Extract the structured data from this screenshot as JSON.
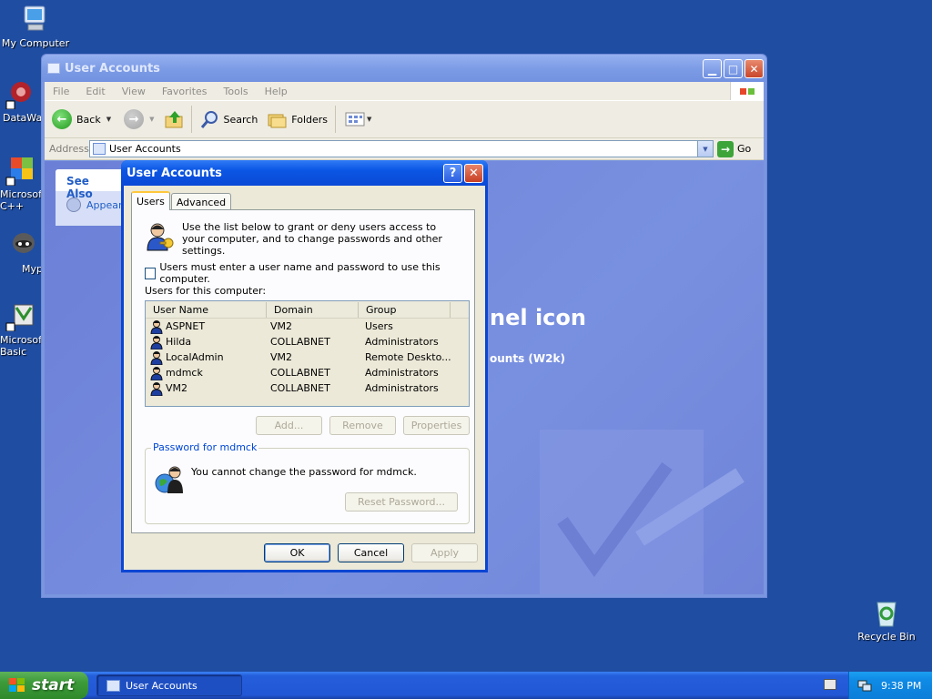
{
  "desktop": {
    "icons": [
      {
        "label": "My Computer"
      },
      {
        "label": "DataWa"
      },
      {
        "label": "Microsoft C++"
      },
      {
        "label": "Myp"
      },
      {
        "label": "Microsoft Basic"
      },
      {
        "label": "Recycle Bin"
      }
    ]
  },
  "explorer": {
    "title": "User Accounts",
    "menu": [
      "File",
      "Edit",
      "View",
      "Favorites",
      "Tools",
      "Help"
    ],
    "toolbar": {
      "back": "Back",
      "search": "Search",
      "folders": "Folders"
    },
    "address": {
      "label": "Address",
      "value": "User Accounts",
      "go": "Go"
    },
    "see_also": {
      "header": "See Also",
      "item": "Appear"
    },
    "heading": "nel icon",
    "subtext": "ounts (W2k)"
  },
  "dialog": {
    "title": "User Accounts",
    "tabs": [
      "Users",
      "Advanced"
    ],
    "intro": "Use the list below to grant or deny users access to your computer, and to change passwords and other settings.",
    "checkbox_label": "Users must enter a user name and password to use this computer.",
    "checkbox_checked": false,
    "users_label": "Users for this computer:",
    "columns": [
      "User Name",
      "Domain",
      "Group"
    ],
    "users": [
      {
        "name": "ASPNET",
        "domain": "VM2",
        "group": "Users"
      },
      {
        "name": "Hilda",
        "domain": "COLLABNET",
        "group": "Administrators"
      },
      {
        "name": "LocalAdmin",
        "domain": "VM2",
        "group": "Remote Deskto..."
      },
      {
        "name": "mdmck",
        "domain": "COLLABNET",
        "group": "Administrators"
      },
      {
        "name": "VM2",
        "domain": "COLLABNET",
        "group": "Administrators"
      }
    ],
    "buttons": {
      "add": "Add...",
      "remove": "Remove",
      "properties": "Properties"
    },
    "password_group": {
      "label": "Password for mdmck",
      "message": "You cannot change the password for mdmck.",
      "reset": "Reset Password..."
    },
    "footer": {
      "ok": "OK",
      "cancel": "Cancel",
      "apply": "Apply"
    }
  },
  "taskbar": {
    "start": "start",
    "task": "User Accounts",
    "clock": "9:38 PM"
  }
}
